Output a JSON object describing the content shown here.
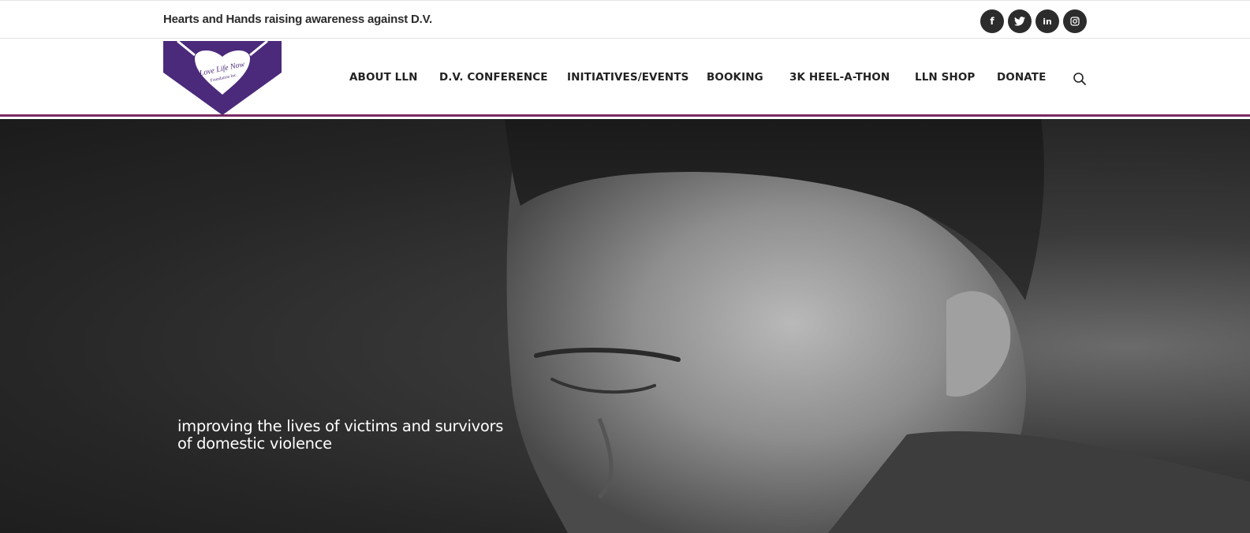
{
  "topbar": {
    "tagline": "Hearts and Hands raising awareness against D.V.",
    "social": [
      {
        "name": "facebook",
        "glyph": "f"
      },
      {
        "name": "twitter",
        "glyph": "t"
      },
      {
        "name": "linkedin",
        "glyph": "in"
      },
      {
        "name": "instagram",
        "glyph": "◘"
      }
    ]
  },
  "logo": {
    "line1": "Love Life Now",
    "line2": "Foundation Inc.",
    "color": "#4b2a7b"
  },
  "nav": {
    "items": [
      "ABOUT LLN",
      "D.V. CONFERENCE",
      "INITIATIVES/EVENTS",
      "BOOKING",
      "3K HEEL-A-THON",
      "LLN SHOP",
      "DONATE"
    ],
    "search_icon": "search-icon",
    "accent": "#7a2a63"
  },
  "hero": {
    "text_line1": "improving the lives of victims and survivors",
    "text_line2": "of domestic violence"
  }
}
